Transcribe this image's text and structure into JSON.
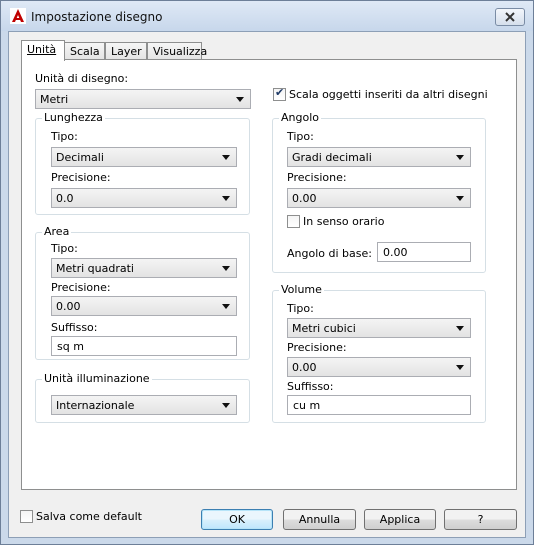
{
  "window": {
    "title": "Impostazione disegno"
  },
  "tabs": [
    {
      "label": "Unità",
      "active": true
    },
    {
      "label": "Scala"
    },
    {
      "label": "Layer"
    },
    {
      "label": "Visualizza"
    }
  ],
  "units": {
    "label": "Unità di disegno:",
    "value": "Metri",
    "scale_inserted_label": "Scala oggetti inseriti da altri disegni",
    "scale_inserted_checked": true
  },
  "length": {
    "title": "Lunghezza",
    "type_label": "Tipo:",
    "type_value": "Decimali",
    "precision_label": "Precisione:",
    "precision_value": "0.0"
  },
  "area": {
    "title": "Area",
    "type_label": "Tipo:",
    "type_value": "Metri quadrati",
    "precision_label": "Precisione:",
    "precision_value": "0.00",
    "suffix_label": "Suffisso:",
    "suffix_value": "sq m"
  },
  "lighting": {
    "title": "Unità illuminazione",
    "value": "Internazionale"
  },
  "angle": {
    "title": "Angolo",
    "type_label": "Tipo:",
    "type_value": "Gradi decimali",
    "precision_label": "Precisione:",
    "precision_value": "0.00",
    "clockwise_label": "In senso orario",
    "clockwise_checked": false,
    "base_label": "Angolo di base:",
    "base_value": "0.00"
  },
  "volume": {
    "title": "Volume",
    "type_label": "Tipo:",
    "type_value": "Metri cubici",
    "precision_label": "Precisione:",
    "precision_value": "0.00",
    "suffix_label": "Suffisso:",
    "suffix_value": "cu m"
  },
  "footer": {
    "save_default_label": "Salva come default",
    "save_default_checked": false,
    "ok_label": "OK",
    "cancel_label": "Annulla",
    "apply_label": "Applica",
    "help_label": "?"
  },
  "colors": {
    "brand": "#c00000",
    "panel": "#ffffff",
    "window_frame": "#cbd9ea"
  },
  "icons": {
    "app": "autocad-a-icon",
    "close": "close-icon",
    "dropdown": "chevron-down-icon",
    "check": "check-icon"
  }
}
